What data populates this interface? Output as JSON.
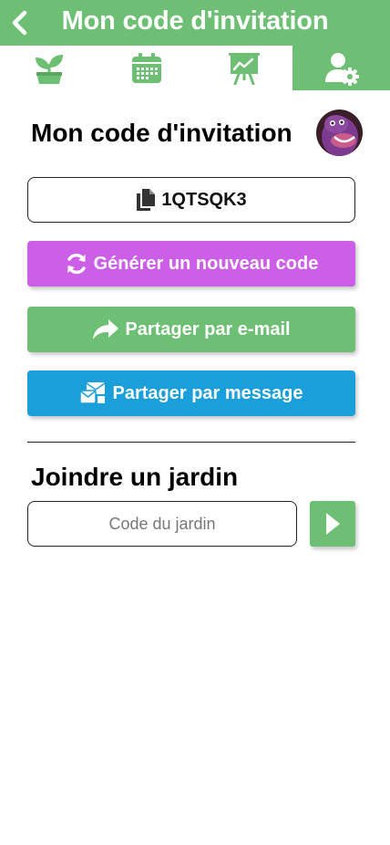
{
  "header": {
    "title": "Mon code d'invitation",
    "back_icon": "chevron-left-icon"
  },
  "tabs": [
    {
      "icon": "seedling-pot-icon",
      "active": false
    },
    {
      "icon": "calendar-icon",
      "active": false
    },
    {
      "icon": "chart-board-icon",
      "active": false
    },
    {
      "icon": "user-settings-icon",
      "active": true
    }
  ],
  "invitation": {
    "title": "Mon code d'invitation",
    "code": "1QTSQK3",
    "code_icon": "copy-icon"
  },
  "actions": {
    "generate_label": "Générer un nouveau code",
    "email_label": "Partager par e-mail",
    "message_label": "Partager par message"
  },
  "join": {
    "title": "Joindre un jardin",
    "placeholder": "Code du jardin",
    "value": ""
  },
  "colors": {
    "green": "#6dbf73",
    "purple": "#cc5ee8",
    "blue": "#1a9fdb",
    "white": "#ffffff"
  }
}
